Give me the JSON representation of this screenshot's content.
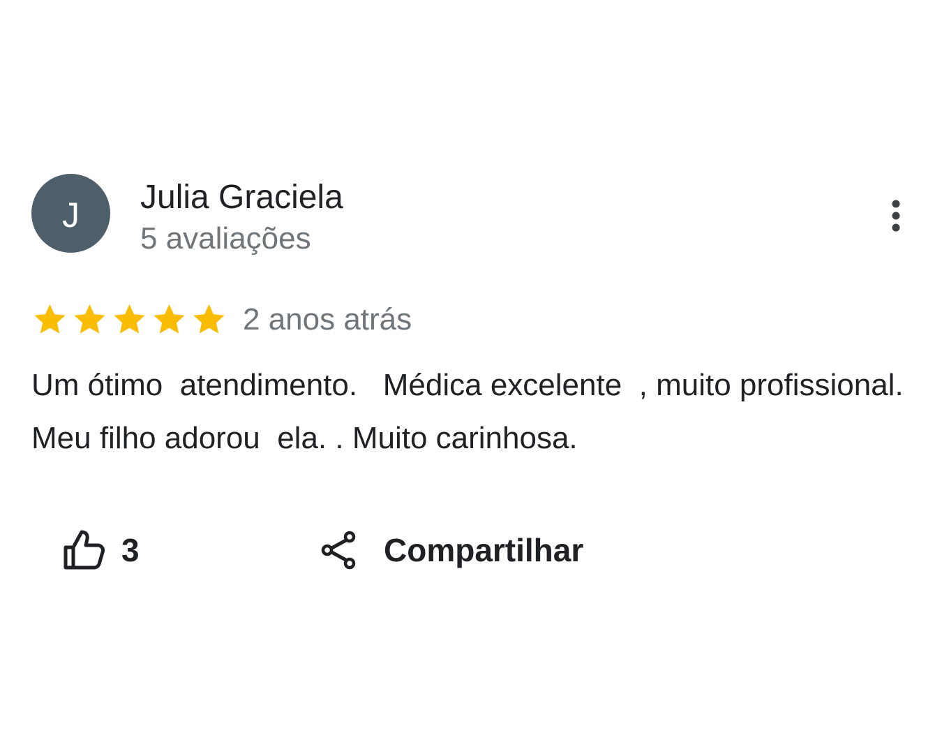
{
  "review": {
    "avatar_initial": "J",
    "avatar_color": "#4f5f6a",
    "author_name": "Julia Graciela",
    "review_count": "5 avaliações",
    "rating": 5,
    "rating_max": 5,
    "star_color": "#fbbc04",
    "date": "2 anos atrás",
    "text": "Um ótimo  atendimento.   Médica excelente  , muito profissional.  Meu filho adorou  ela. . Muito carinhosa.",
    "more_icon": "more-vertical-icon",
    "actions": {
      "like_icon": "thumbs-up-icon",
      "like_count": "3",
      "share_icon": "share-icon",
      "share_label": "Compartilhar"
    }
  }
}
